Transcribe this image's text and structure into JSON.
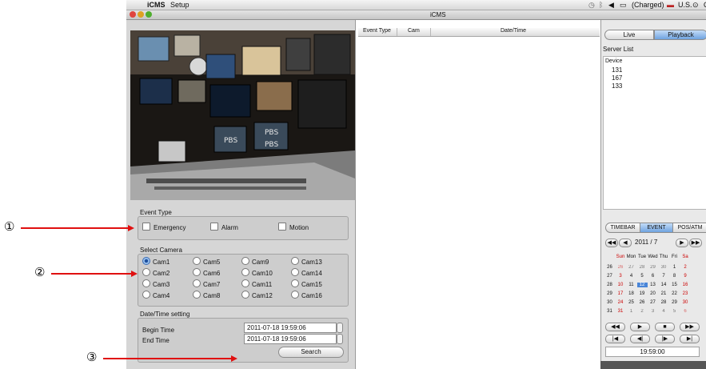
{
  "menubar": {
    "app_name": "iCMS",
    "menu_setup": "Setup",
    "battery": "(Charged)",
    "input_source": "U.S."
  },
  "window": {
    "title": "iCMS"
  },
  "event_type": {
    "label": "Event Type",
    "options": [
      "Emergency",
      "Alarm",
      "Motion"
    ]
  },
  "select_camera": {
    "label": "Select Camera",
    "cams": [
      [
        "Cam1",
        "Cam5",
        "Cam9",
        "Cam13"
      ],
      [
        "Cam2",
        "Cam6",
        "Cam10",
        "Cam14"
      ],
      [
        "Cam3",
        "Cam7",
        "Cam11",
        "Cam15"
      ],
      [
        "Cam4",
        "Cam8",
        "Cam12",
        "Cam16"
      ]
    ],
    "selected": "Cam1"
  },
  "datetime": {
    "label": "Date/Time setting",
    "begin_label": "Begin Time",
    "begin_value": "2011-07-18 19:59:06",
    "end_label": "End Time",
    "end_value": "2011-07-18 19:59:06",
    "search_label": "Search"
  },
  "event_list": {
    "columns": [
      "Event Type",
      "Cam",
      "Date/Time"
    ]
  },
  "right": {
    "live_label": "Live",
    "playback_label": "Playback",
    "server_list_label": "Server List",
    "device_header": "Device",
    "devices": [
      "131",
      "167",
      "133"
    ],
    "tabs": [
      "TIMEBAR",
      "EVENT",
      "POS/ATM"
    ],
    "active_tab": "EVENT",
    "month_label": "2011 / 7",
    "weekdays": [
      "Sun",
      "Mon",
      "Tue",
      "Wed",
      "Thu",
      "Fri",
      "Sa"
    ],
    "weeks": [
      {
        "wk": "26",
        "days": [
          "26",
          "27",
          "28",
          "29",
          "30",
          "1",
          "2"
        ]
      },
      {
        "wk": "27",
        "days": [
          "3",
          "4",
          "5",
          "6",
          "7",
          "8",
          "9"
        ]
      },
      {
        "wk": "28",
        "days": [
          "10",
          "11",
          "12",
          "13",
          "14",
          "15",
          "16"
        ]
      },
      {
        "wk": "29",
        "days": [
          "17",
          "18",
          "19",
          "20",
          "21",
          "22",
          "23"
        ]
      },
      {
        "wk": "30",
        "days": [
          "24",
          "25",
          "26",
          "27",
          "28",
          "29",
          "30"
        ]
      },
      {
        "wk": "31",
        "days": [
          "31",
          "1",
          "2",
          "3",
          "4",
          "5",
          "6"
        ]
      }
    ],
    "selected_day": "12",
    "time": "19:59:00"
  },
  "annotations": [
    "①",
    "②",
    "③"
  ],
  "colors": {
    "accent": "#4a86d8",
    "arrow": "#e01010",
    "weekend": "#cc0000"
  },
  "icons": [
    "apple-icon",
    "clock-icon",
    "volume-icon",
    "battery-icon",
    "flag-icon",
    "user-icon",
    "spotlight-icon"
  ]
}
